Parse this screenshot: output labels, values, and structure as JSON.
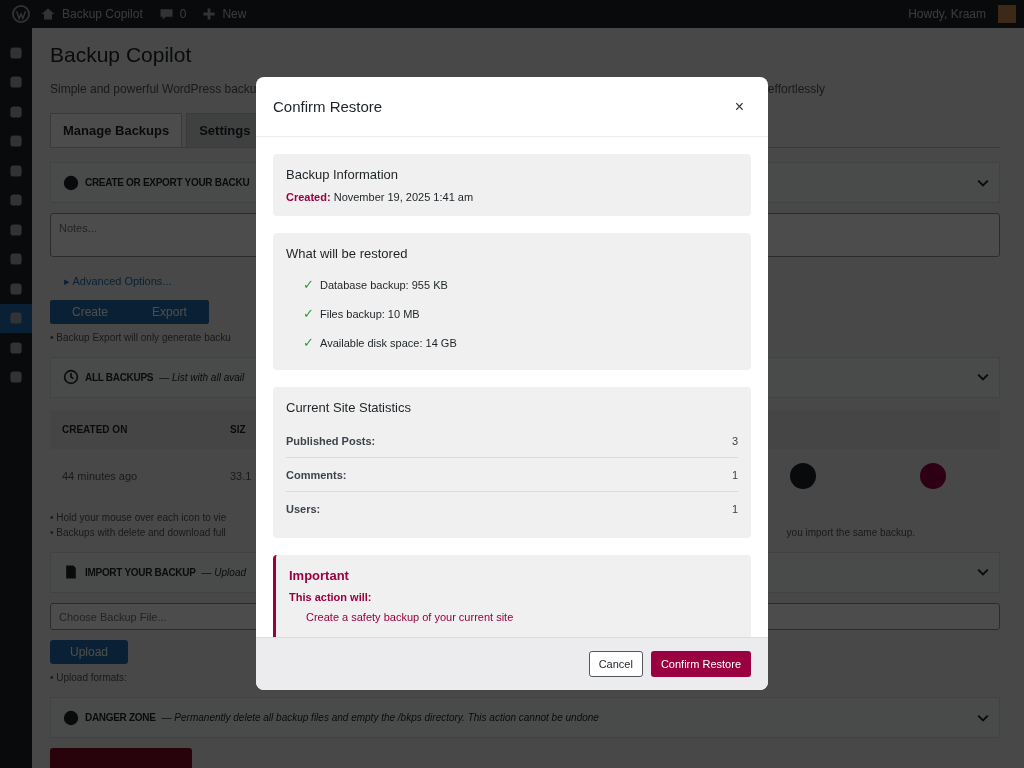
{
  "admin_bar": {
    "site": "Backup Copilot",
    "comments": "0",
    "new": "New",
    "greeting": "Howdy, Kraam"
  },
  "sidebar": {
    "items": [
      {
        "selected": false
      },
      {
        "selected": false
      },
      {
        "selected": false
      },
      {
        "selected": false
      },
      {
        "selected": false
      },
      {
        "selected": false
      },
      {
        "selected": false
      },
      {
        "selected": false
      },
      {
        "selected": false
      },
      {
        "selected": true
      },
      {
        "selected": false
      },
      {
        "selected": false
      }
    ]
  },
  "page": {
    "title": "Backup Copilot",
    "subtitle_start": "Simple and powerful WordPress backu",
    "subtitle_end": "effortlessly"
  },
  "tabs": [
    {
      "label": "Manage Backups",
      "selected": true
    },
    {
      "label": "Settings",
      "selected": false
    }
  ],
  "create_section": {
    "heading": "CREATE OR EXPORT YOUR BACKU",
    "notes_placeholder": "Notes...",
    "advanced": "▸ Advanced Options...",
    "buttons": [
      "Create",
      "Export"
    ],
    "note": "• Backup Export will only generate backu"
  },
  "backups_section": {
    "heading": "ALL BACKUPS",
    "description": "— List with all avail",
    "columns": [
      "CREATED ON",
      "SIZ"
    ],
    "rows": [
      {
        "created": "44 minutes ago",
        "size": "33.1"
      }
    ],
    "notes": [
      "• Hold your mouse over each icon to vie",
      "• Backups with delete and download full"
    ],
    "note_end": "you import the same backup."
  },
  "import_section": {
    "heading": "IMPORT YOUR BACKUP",
    "description": "— Upload",
    "file_placeholder": "Choose Backup File...",
    "button": "Upload",
    "formats": "• Upload formats:"
  },
  "danger_section": {
    "heading": "DANGER ZONE",
    "description": "— Permanently delete all backup files and empty the /bkps directory. This action cannot be undone"
  },
  "modal": {
    "title": "Confirm Restore",
    "close": "×",
    "backup_info": {
      "heading": "Backup Information",
      "label": "Created:",
      "value": "November 19, 2025 1:41 am"
    },
    "restore": {
      "heading": "What will be restored",
      "items": [
        {
          "check": "✓",
          "text": "Database backup: 955 KB"
        },
        {
          "check": "✓",
          "text": "Files backup: 10 MB"
        },
        {
          "check": "✓",
          "text": "Available disk space: 14 GB"
        }
      ]
    },
    "stats": {
      "heading": "Current Site Statistics",
      "rows": [
        {
          "label": "Published Posts:",
          "value": "3"
        },
        {
          "label": "Comments:",
          "value": "1"
        },
        {
          "label": "Users:",
          "value": "1"
        }
      ]
    },
    "important": {
      "heading": "Important",
      "lead": "This action will:",
      "items": [
        "Create a safety backup of your current site"
      ]
    },
    "cancel": "Cancel",
    "confirm": "Confirm Restore"
  }
}
